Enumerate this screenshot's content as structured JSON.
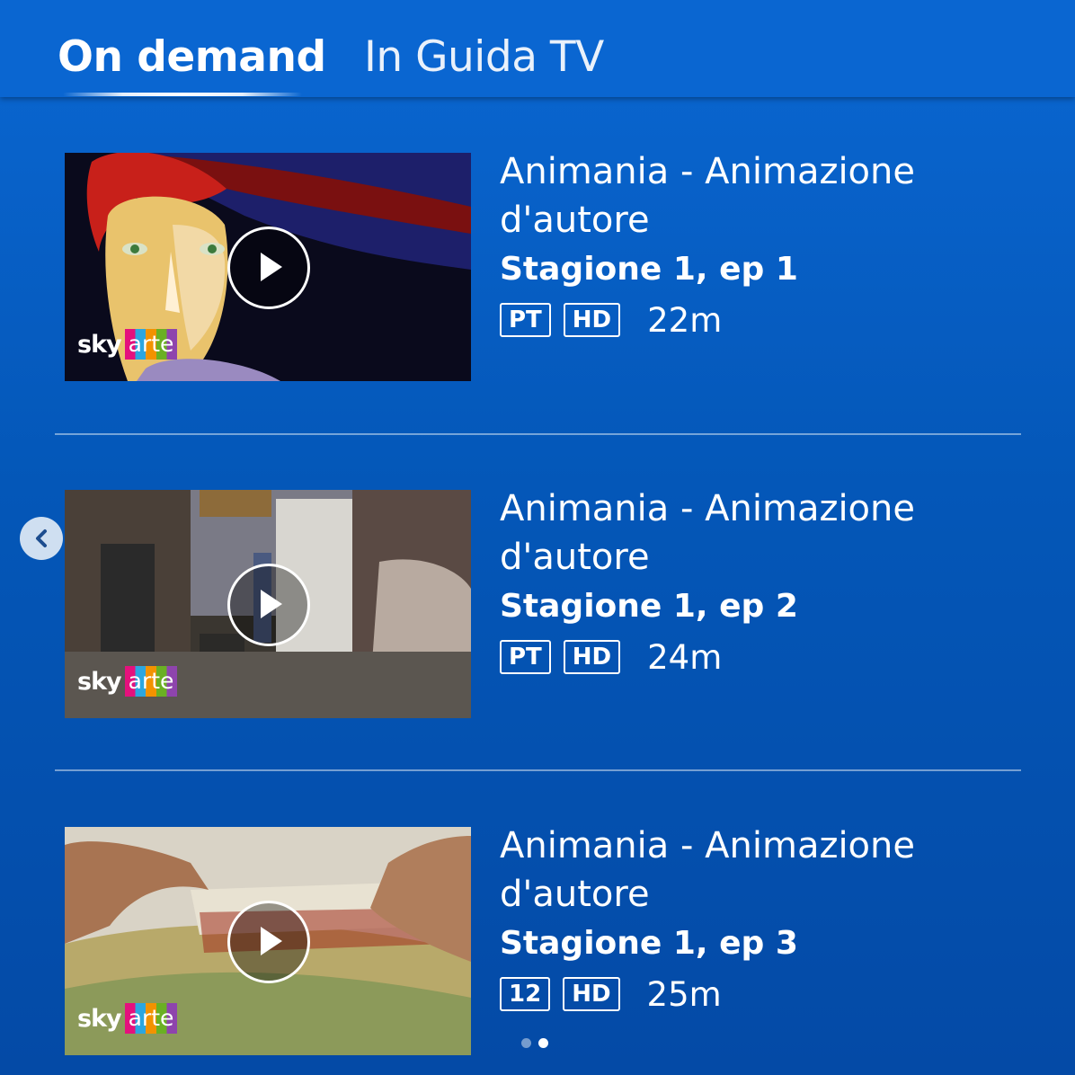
{
  "tabs": [
    {
      "label": "On demand",
      "active": true
    },
    {
      "label": "In Guida TV",
      "active": false
    }
  ],
  "episodes": [
    {
      "title": "Animania - Animazione d'autore",
      "subtitle": "Stagione 1, ep 1",
      "rating": "PT",
      "quality": "HD",
      "duration": "22m",
      "logo_sky": "sky",
      "logo_arte": "arte"
    },
    {
      "title": "Animania - Animazione d'autore",
      "subtitle": "Stagione 1, ep 2",
      "rating": "PT",
      "quality": "HD",
      "duration": "24m",
      "logo_sky": "sky",
      "logo_arte": "arte"
    },
    {
      "title": "Animania - Animazione d'autore",
      "subtitle": "Stagione 1, ep 3",
      "rating": "12",
      "quality": "HD",
      "duration": "25m",
      "logo_sky": "sky",
      "logo_arte": "arte"
    }
  ],
  "icons": {
    "play": "play-icon",
    "back": "chevron-left-icon"
  },
  "pagination": {
    "pages": 2,
    "current": 2
  },
  "colors": {
    "background": "#0457b8",
    "header": "#0a66d1",
    "text": "#ffffff"
  }
}
